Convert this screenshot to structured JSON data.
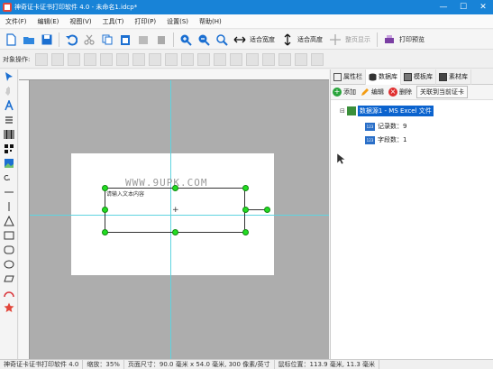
{
  "window": {
    "title": "神奇证卡证书打印软件 4.0 - 未命名1.idcp*"
  },
  "menu": [
    "文件(F)",
    "编辑(E)",
    "视图(V)",
    "工具(T)",
    "打印(P)",
    "设置(S)",
    "帮助(H)"
  ],
  "toolbar": {
    "fit_width": "适合宽度",
    "fit_height": "适合高度",
    "whole_page": "整页显示",
    "print_preview": "打印预览"
  },
  "align_toolbar": {
    "label": "对象操作:"
  },
  "canvas": {
    "watermark": "WWW.9UPK.COM",
    "textbox_content": "请输入文本内容"
  },
  "panel": {
    "tabs": [
      "属性栏",
      "数据库",
      "模板库",
      "素材库"
    ],
    "actions": {
      "add": "添加",
      "edit": "编辑",
      "delete": "删除",
      "link": "关联到当前证卡"
    },
    "tree": {
      "root": "数据源1 - MS Excel 文件",
      "children": [
        "记录数：9",
        "字段数：1"
      ]
    }
  },
  "status": {
    "app": "神奇证卡证书打印软件 4.0",
    "zoom": "缩放：35%",
    "page_size": "页面尺寸：90.0 毫米 x 54.0 毫米, 300 像素/英寸",
    "mouse_pos": "鼠标位置：113.9 毫米, 11.3 毫米"
  },
  "colors": {
    "title_bar": "#1883d7",
    "handle": "#22dd22",
    "guide": "#5fd4e0",
    "selection": "#0b63ce"
  },
  "icons": [
    "app-icon",
    "new-icon",
    "open-icon",
    "save-icon",
    "undo-icon",
    "cut-icon",
    "copy-icon",
    "paste-icon",
    "zoom-in-icon",
    "zoom-out-icon",
    "zoom-fit-icon",
    "print-icon",
    "database-icon",
    "excel-icon"
  ]
}
